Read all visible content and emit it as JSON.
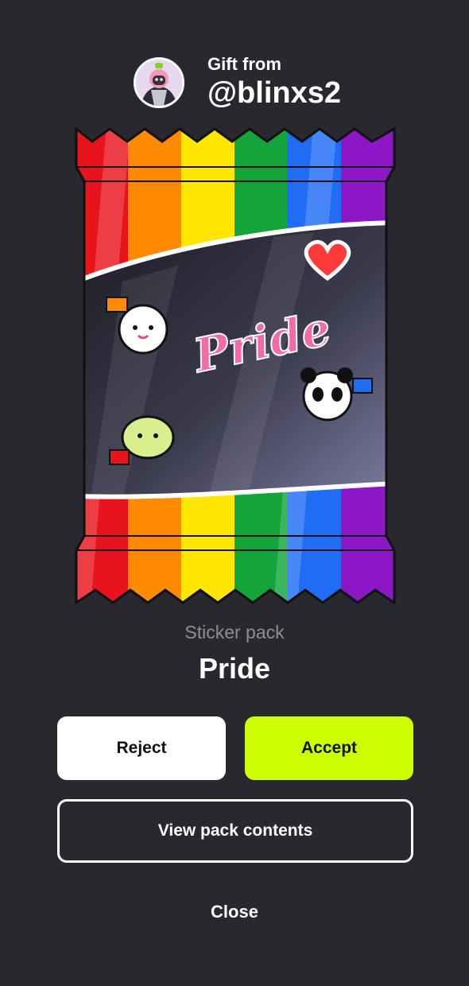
{
  "gift": {
    "from_label": "Gift from",
    "username": "@blinxs2"
  },
  "pack": {
    "type_label": "Sticker pack",
    "name": "Pride",
    "artwork_text": "Pride",
    "stripe_colors": [
      "#e8141c",
      "#ff8a00",
      "#ffe600",
      "#13a43a",
      "#1f6cf5",
      "#8c17c4"
    ],
    "stickers": [
      "ghost-with-flag-sticker",
      "rainbow-heart-sticker",
      "pride-lettering-sticker",
      "panda-with-flag-sticker",
      "frog-with-flag-sticker"
    ]
  },
  "actions": {
    "reject_label": "Reject",
    "accept_label": "Accept",
    "view_label": "View pack contents",
    "close_label": "Close"
  },
  "colors": {
    "background": "#29282e",
    "accept": "#ccff00",
    "muted_text": "#8f8e94"
  }
}
